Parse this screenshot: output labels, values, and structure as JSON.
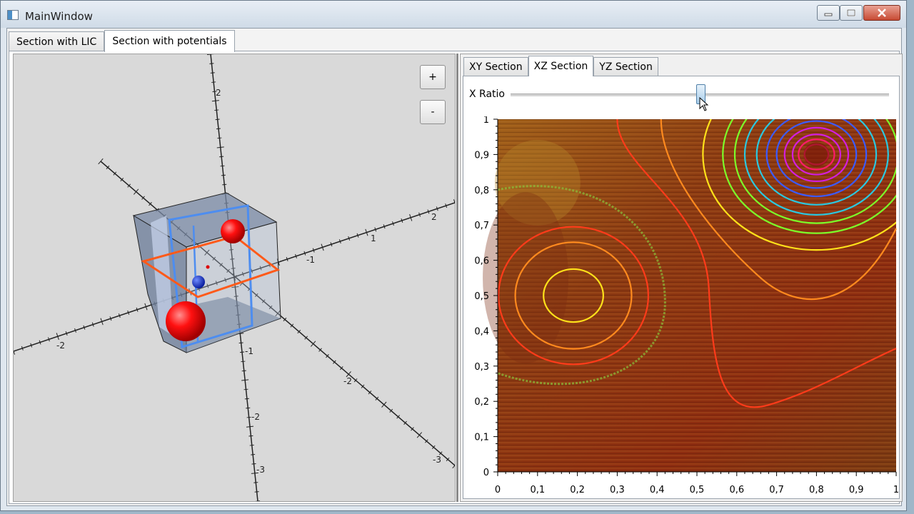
{
  "window": {
    "title": "MainWindow"
  },
  "tabs": [
    "Section with LIC",
    "Section with potentials"
  ],
  "zoom": {
    "plus": "+",
    "minus": "-"
  },
  "sections": [
    "XY Section",
    "XZ Section",
    "YZ Section"
  ],
  "slider": {
    "label": "X Ratio",
    "value": 0.5
  },
  "chart_data": {
    "type": "contour",
    "x_ticks": [
      "0",
      "0,1",
      "0,2",
      "0,3",
      "0,4",
      "0,5",
      "0,6",
      "0,7",
      "0,8",
      "0,9",
      "1"
    ],
    "y_ticks": [
      "0",
      "0,1",
      "0,2",
      "0,3",
      "0,4",
      "0,5",
      "0,6",
      "0,7",
      "0,8",
      "0,9",
      "1"
    ],
    "xlim": [
      0,
      1
    ],
    "ylim": [
      0,
      1
    ],
    "centers": [
      {
        "x": 0.19,
        "y": 0.5
      },
      {
        "x": 0.8,
        "y": 0.9
      }
    ],
    "colors": {
      "red": "#ff3b1a",
      "orange": "#ff8a1e",
      "yellow": "#ffe21a",
      "green": "#7cff2a",
      "cyan": "#2ac8e0",
      "blue": "#3b5bff",
      "magenta": "#d21ee0",
      "pink": "#ff1a6b"
    }
  },
  "axis3d": {
    "y": [
      "2",
      "1",
      "-1",
      "-2",
      "-3"
    ],
    "x": [
      "2",
      "1",
      "-1",
      "-2",
      "-3"
    ],
    "z": [
      "2",
      "1",
      "-1",
      "-2",
      "-3"
    ]
  }
}
